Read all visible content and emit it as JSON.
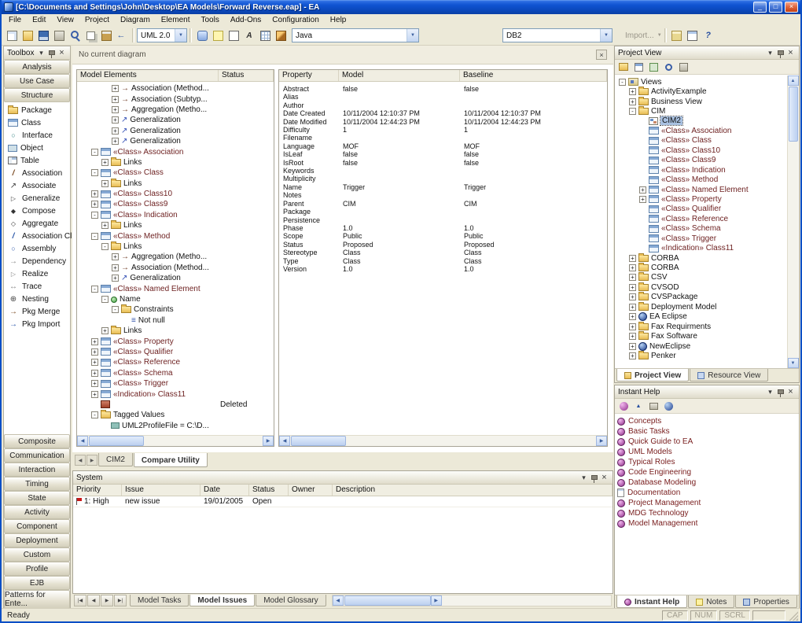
{
  "colors": {
    "titlebar_blue": "#0B49BD",
    "chrome": "#ECE9D8",
    "selection_blue": "#A8C0E0",
    "stereotype_text": "#6E2222",
    "help_item_text": "#7A2020",
    "flag_red": "#C81818"
  },
  "window": {
    "title": "[C:\\Documents and Settings\\John\\Desktop\\EA Models\\Forward Reverse.eap] - EA",
    "controls": [
      {
        "name": "minimize",
        "glyph": "_"
      },
      {
        "name": "maximize",
        "glyph": "□"
      },
      {
        "name": "close",
        "glyph": "×"
      }
    ]
  },
  "menu": {
    "items": [
      "File",
      "Edit",
      "View",
      "Project",
      "Diagram",
      "Element",
      "Tools",
      "Add-Ons",
      "Configuration",
      "Help"
    ]
  },
  "toolbar": {
    "left_icons": [
      "new-file",
      "open-folder",
      "save",
      "print",
      "search",
      "copy",
      "paste",
      "undo"
    ],
    "uml_combo": "UML 2.0",
    "mid_icons": [
      "hyperlink",
      "note",
      "shape",
      "text",
      "grid",
      "pencil"
    ],
    "language_combo": "Java",
    "db_combo": "DB2",
    "import_label": "Import...",
    "right_icons": [
      "package-browse",
      "diagram-list",
      "help"
    ]
  },
  "toolbox": {
    "title": "Toolbox",
    "top_sections": [
      {
        "label": "Analysis"
      },
      {
        "label": "Use Case"
      },
      {
        "label": "Structure",
        "expanded": true
      }
    ],
    "structure_items": [
      {
        "icon": "package",
        "label": "Package"
      },
      {
        "icon": "class",
        "label": "Class"
      },
      {
        "icon": "interface",
        "label": "Interface"
      },
      {
        "icon": "object",
        "label": "Object"
      },
      {
        "icon": "table",
        "label": "Table"
      },
      {
        "icon": "association",
        "label": "Association"
      },
      {
        "icon": "associate",
        "label": "Associate"
      },
      {
        "icon": "generalize",
        "label": "Generalize"
      },
      {
        "icon": "compose",
        "label": "Compose"
      },
      {
        "icon": "aggregate",
        "label": "Aggregate"
      },
      {
        "icon": "association-class",
        "label": "Association Cl..."
      },
      {
        "icon": "assembly",
        "label": "Assembly"
      },
      {
        "icon": "dependency",
        "label": "Dependency"
      },
      {
        "icon": "realize",
        "label": "Realize"
      },
      {
        "icon": "trace",
        "label": "Trace"
      },
      {
        "icon": "nesting",
        "label": "Nesting"
      },
      {
        "icon": "pkg-merge",
        "label": "Pkg Merge"
      },
      {
        "icon": "pkg-import",
        "label": "Pkg Import"
      }
    ],
    "bottom_sections": [
      "Composite",
      "Communication",
      "Interaction",
      "Timing",
      "State",
      "Activity",
      "Component",
      "Deployment",
      "Custom",
      "Profile",
      "EJB",
      "Patterns for Ente..."
    ]
  },
  "diagram_bar": {
    "label": "No current diagram"
  },
  "model_elements": {
    "columns": [
      "Model Elements",
      "Status"
    ],
    "rows": [
      {
        "indent": 3,
        "exp": "+",
        "icon": "assoc-arrow",
        "label": "Association (Method..."
      },
      {
        "indent": 3,
        "exp": "+",
        "icon": "assoc-arrow",
        "label": "Association (Subtyp..."
      },
      {
        "indent": 3,
        "exp": "+",
        "icon": "assoc-arrow",
        "label": "Aggregation (Metho..."
      },
      {
        "indent": 3,
        "exp": "+",
        "icon": "gen-arrow",
        "label": "Generalization"
      },
      {
        "indent": 3,
        "exp": "+",
        "icon": "gen-arrow",
        "label": "Generalization"
      },
      {
        "indent": 3,
        "exp": "+",
        "icon": "gen-arrow",
        "label": "Generalization"
      },
      {
        "indent": 1,
        "exp": "-",
        "icon": "class",
        "label": "«Class» Association"
      },
      {
        "indent": 2,
        "exp": "+",
        "icon": "folder",
        "label": "Links"
      },
      {
        "indent": 1,
        "exp": "-",
        "icon": "class",
        "label": "«Class» Class"
      },
      {
        "indent": 2,
        "exp": "+",
        "icon": "folder",
        "label": "Links"
      },
      {
        "indent": 1,
        "exp": "+",
        "icon": "class",
        "label": "«Class» Class10"
      },
      {
        "indent": 1,
        "exp": "+",
        "icon": "class",
        "label": "«Class» Class9"
      },
      {
        "indent": 1,
        "exp": "-",
        "icon": "class",
        "label": "«Class» Indication"
      },
      {
        "indent": 2,
        "exp": "+",
        "icon": "folder",
        "label": "Links"
      },
      {
        "indent": 1,
        "exp": "-",
        "icon": "class",
        "label": "«Class» Method"
      },
      {
        "indent": 2,
        "exp": "-",
        "icon": "folder",
        "label": "Links"
      },
      {
        "indent": 3,
        "exp": "+",
        "icon": "assoc-arrow",
        "label": "Aggregation (Metho..."
      },
      {
        "indent": 3,
        "exp": "+",
        "icon": "assoc-arrow",
        "label": "Association (Method..."
      },
      {
        "indent": 3,
        "exp": "+",
        "icon": "gen-arrow",
        "label": "Generalization"
      },
      {
        "indent": 1,
        "exp": "-",
        "icon": "class",
        "label": "«Class» Named Element"
      },
      {
        "indent": 2,
        "exp": "-",
        "icon": "attr",
        "label": "Name"
      },
      {
        "indent": 3,
        "exp": "-",
        "icon": "folder",
        "label": "Constraints"
      },
      {
        "indent": 4,
        "exp": "",
        "icon": "constraint",
        "label": "Not null"
      },
      {
        "indent": 2,
        "exp": "+",
        "icon": "folder",
        "label": "Links"
      },
      {
        "indent": 1,
        "exp": "+",
        "icon": "class",
        "label": "«Class» Property"
      },
      {
        "indent": 1,
        "exp": "+",
        "icon": "class",
        "label": "«Class» Qualifier"
      },
      {
        "indent": 1,
        "exp": "+",
        "icon": "class",
        "label": "«Class» Reference"
      },
      {
        "indent": 1,
        "exp": "+",
        "icon": "class",
        "label": "«Class» Schema"
      },
      {
        "indent": 1,
        "exp": "+",
        "icon": "class",
        "label": "«Class» Trigger"
      },
      {
        "indent": 1,
        "exp": "+",
        "icon": "class",
        "label": "«Indication» Class11"
      },
      {
        "indent": 1,
        "exp": "",
        "icon": "deleted",
        "label": "",
        "status": "Deleted"
      },
      {
        "indent": 1,
        "exp": "-",
        "icon": "folder",
        "label": "Tagged Values"
      },
      {
        "indent": 2,
        "exp": "",
        "icon": "tag",
        "label": "UML2ProfileFile = C:\\D..."
      }
    ],
    "tabs": [
      {
        "label": "CIM2"
      },
      {
        "label": "Compare Utility",
        "active": true
      }
    ]
  },
  "properties": {
    "columns": [
      "Property",
      "Model",
      "Baseline"
    ],
    "rows": [
      [
        "Abstract",
        "false",
        "false"
      ],
      [
        "Alias",
        "",
        ""
      ],
      [
        "Author",
        "",
        ""
      ],
      [
        "Date Created",
        "10/11/2004 12:10:37 PM",
        "10/11/2004 12:10:37 PM"
      ],
      [
        "Date Modified",
        "10/11/2004 12:44:23 PM",
        "10/11/2004 12:44:23 PM"
      ],
      [
        "Difficulty",
        "1",
        "1"
      ],
      [
        "Filename",
        "",
        ""
      ],
      [
        "Language",
        "MOF",
        "MOF"
      ],
      [
        "IsLeaf",
        "false",
        "false"
      ],
      [
        "IsRoot",
        "false",
        "false"
      ],
      [
        "Keywords",
        "",
        ""
      ],
      [
        "Multiplicity",
        "",
        ""
      ],
      [
        "Name",
        "Trigger",
        "Trigger"
      ],
      [
        "Notes",
        "",
        ""
      ],
      [
        "Parent",
        "CIM",
        "CIM"
      ],
      [
        "Package",
        "",
        ""
      ],
      [
        "Persistence",
        "",
        ""
      ],
      [
        "Phase",
        "1.0",
        "1.0"
      ],
      [
        "Scope",
        "Public",
        "Public"
      ],
      [
        "Status",
        "Proposed",
        "Proposed"
      ],
      [
        "Stereotype",
        "Class",
        "Class"
      ],
      [
        "Type",
        "Class",
        "Class"
      ],
      [
        "Version",
        "1.0",
        "1.0"
      ]
    ]
  },
  "system": {
    "title": "System",
    "columns": [
      "Priority",
      "Issue",
      "Date",
      "Status",
      "Owner",
      "Description"
    ],
    "rows": [
      {
        "priority": "1: High",
        "issue": "new issue",
        "date": "19/01/2005",
        "status": "Open",
        "owner": "",
        "description": ""
      }
    ],
    "tabs": [
      {
        "label": "Model Tasks"
      },
      {
        "label": "Model Issues",
        "active": true
      },
      {
        "label": "Model Glossary"
      }
    ]
  },
  "project_view": {
    "title": "Project View",
    "toolbar_icons": [
      "new-package",
      "new-diagram",
      "new-element",
      "find",
      "options"
    ],
    "tree": [
      {
        "indent": 0,
        "exp": "-",
        "icon": "views",
        "label": "Views"
      },
      {
        "indent": 1,
        "exp": "+",
        "icon": "package",
        "label": "ActivityExample"
      },
      {
        "indent": 1,
        "exp": "+",
        "icon": "package",
        "label": "Business View"
      },
      {
        "indent": 1,
        "exp": "-",
        "icon": "package",
        "label": "CIM"
      },
      {
        "indent": 2,
        "exp": "",
        "icon": "diagram",
        "label": "CIM2",
        "selected": true
      },
      {
        "indent": 2,
        "exp": "",
        "icon": "class",
        "label": "«Class» Association"
      },
      {
        "indent": 2,
        "exp": "",
        "icon": "class",
        "label": "«Class» Class"
      },
      {
        "indent": 2,
        "exp": "",
        "icon": "class",
        "label": "«Class» Class10"
      },
      {
        "indent": 2,
        "exp": "",
        "icon": "class",
        "label": "«Class» Class9"
      },
      {
        "indent": 2,
        "exp": "",
        "icon": "class",
        "label": "«Class» Indication"
      },
      {
        "indent": 2,
        "exp": "",
        "icon": "class",
        "label": "«Class» Method"
      },
      {
        "indent": 2,
        "exp": "+",
        "icon": "class",
        "label": "«Class» Named Element"
      },
      {
        "indent": 2,
        "exp": "+",
        "icon": "class",
        "label": "«Class» Property"
      },
      {
        "indent": 2,
        "exp": "",
        "icon": "class",
        "label": "«Class» Qualifier"
      },
      {
        "indent": 2,
        "exp": "",
        "icon": "class",
        "label": "«Class» Reference"
      },
      {
        "indent": 2,
        "exp": "",
        "icon": "class",
        "label": "«Class» Schema"
      },
      {
        "indent": 2,
        "exp": "",
        "icon": "class",
        "label": "«Class» Trigger"
      },
      {
        "indent": 2,
        "exp": "",
        "icon": "class",
        "label": "«Indication» Class11"
      },
      {
        "indent": 1,
        "exp": "+",
        "icon": "package",
        "label": "CORBA"
      },
      {
        "indent": 1,
        "exp": "+",
        "icon": "package",
        "label": "CORBA"
      },
      {
        "indent": 1,
        "exp": "+",
        "icon": "package",
        "label": "CSV"
      },
      {
        "indent": 1,
        "exp": "+",
        "icon": "package",
        "label": "CVSOD"
      },
      {
        "indent": 1,
        "exp": "+",
        "icon": "package",
        "label": "CVSPackage"
      },
      {
        "indent": 1,
        "exp": "+",
        "icon": "package",
        "label": "Deployment Model"
      },
      {
        "indent": 1,
        "exp": "+",
        "icon": "model",
        "label": "EA Eclipse"
      },
      {
        "indent": 1,
        "exp": "+",
        "icon": "package",
        "label": "Fax Requirments"
      },
      {
        "indent": 1,
        "exp": "+",
        "icon": "package",
        "label": "Fax Software"
      },
      {
        "indent": 1,
        "exp": "+",
        "icon": "model",
        "label": "NewEclipse"
      },
      {
        "indent": 1,
        "exp": "+",
        "icon": "package",
        "label": "Penker"
      }
    ],
    "tabs": [
      {
        "label": "Project View",
        "icon": "project-tab",
        "active": true
      },
      {
        "label": "Resource View",
        "icon": "resource-tab"
      }
    ]
  },
  "instant_help": {
    "title": "Instant Help",
    "toolbar_icons": [
      "favorites",
      "up-level",
      "print-help",
      "web"
    ],
    "items": [
      {
        "icon": "ball",
        "label": "Concepts"
      },
      {
        "icon": "ball",
        "label": "Basic Tasks"
      },
      {
        "icon": "ball",
        "label": "Quick Guide to EA"
      },
      {
        "icon": "ball",
        "label": "UML Models"
      },
      {
        "icon": "ball",
        "label": "Typical Roles"
      },
      {
        "icon": "ball",
        "label": "Code Engineering"
      },
      {
        "icon": "ball",
        "label": "Database Modeling"
      },
      {
        "icon": "doc",
        "label": "Documentation"
      },
      {
        "icon": "ball",
        "label": "Project Management"
      },
      {
        "icon": "ball",
        "label": "MDG Technology"
      },
      {
        "icon": "ball",
        "label": "Model Management"
      }
    ],
    "tabs": [
      {
        "label": "Instant Help",
        "icon": "help-tab",
        "active": true
      },
      {
        "label": "Notes",
        "icon": "notes-tab"
      },
      {
        "label": "Properties",
        "icon": "props-tab"
      }
    ]
  },
  "statusbar": {
    "ready": "Ready",
    "indicators": [
      "CAP",
      "NUM",
      "SCRL"
    ]
  }
}
